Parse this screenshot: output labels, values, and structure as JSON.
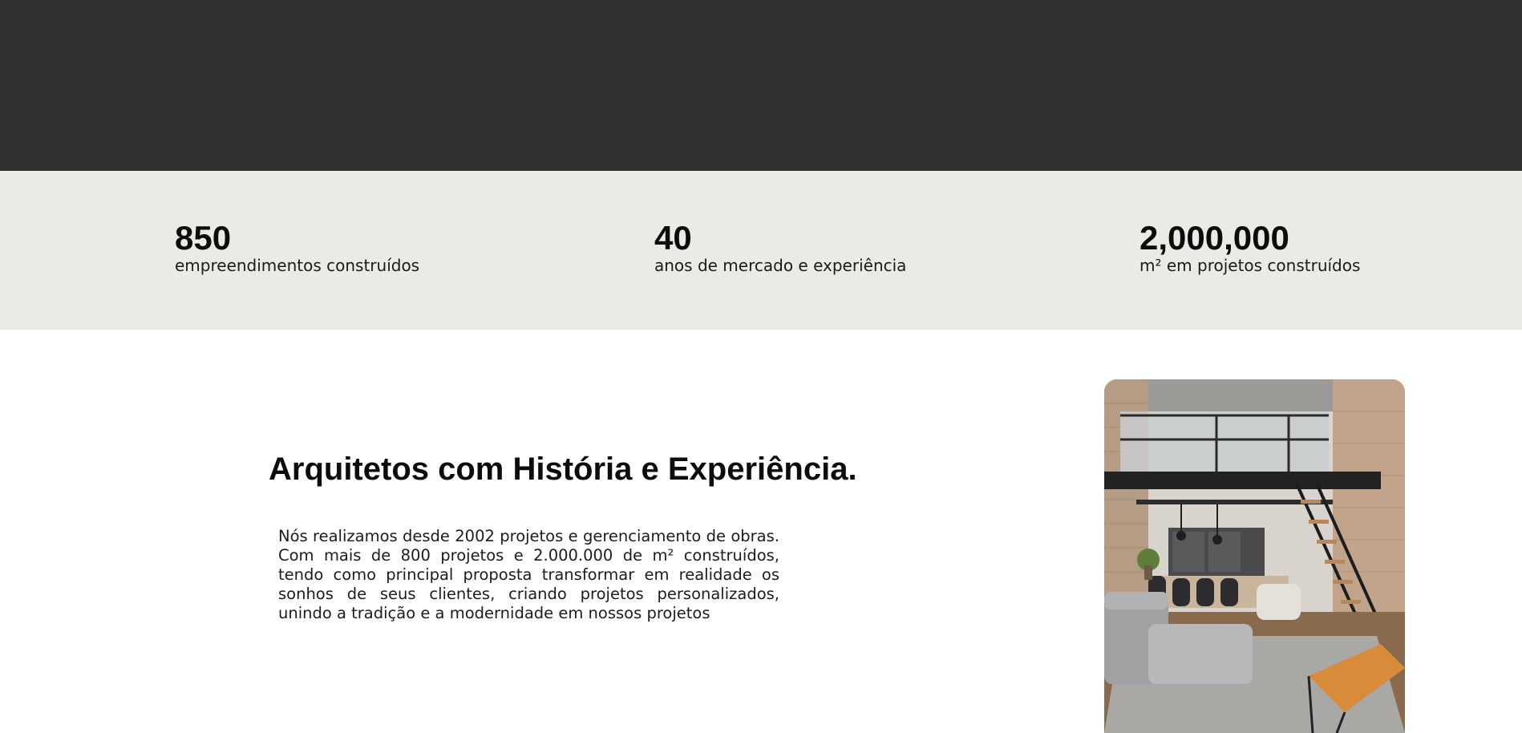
{
  "stats": [
    {
      "value": "850",
      "label": "empreendimentos construídos"
    },
    {
      "value": "40",
      "label": "anos de mercado e experiência"
    },
    {
      "value": "2,000,000",
      "label": "m² em projetos construídos"
    }
  ],
  "about": {
    "heading": "Arquitetos com História e Experiência.",
    "body": "Nós realizamos desde 2002 projetos e gerenciamento de obras. Com mais de 800 projetos e 2.000.000 de m² construídos, tendo como principal proposta transformar em realidade os sonhos de seus clientes, criando projetos personalizados, unindo a tradição e a modernidade em nossos projetos"
  },
  "colors": {
    "hero_background": "#303030",
    "stats_background": "#ebebe6",
    "text": "#0c0c0c"
  }
}
